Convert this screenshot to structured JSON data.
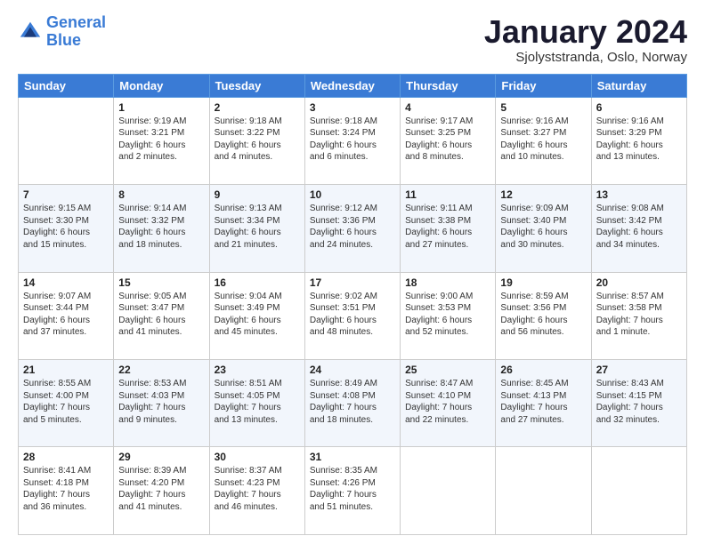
{
  "header": {
    "logo_line1": "General",
    "logo_line2": "Blue",
    "month_title": "January 2024",
    "location": "Sjolyststranda, Oslo, Norway"
  },
  "weekdays": [
    "Sunday",
    "Monday",
    "Tuesday",
    "Wednesday",
    "Thursday",
    "Friday",
    "Saturday"
  ],
  "weeks": [
    [
      {
        "day": "",
        "info": ""
      },
      {
        "day": "1",
        "info": "Sunrise: 9:19 AM\nSunset: 3:21 PM\nDaylight: 6 hours\nand 2 minutes."
      },
      {
        "day": "2",
        "info": "Sunrise: 9:18 AM\nSunset: 3:22 PM\nDaylight: 6 hours\nand 4 minutes."
      },
      {
        "day": "3",
        "info": "Sunrise: 9:18 AM\nSunset: 3:24 PM\nDaylight: 6 hours\nand 6 minutes."
      },
      {
        "day": "4",
        "info": "Sunrise: 9:17 AM\nSunset: 3:25 PM\nDaylight: 6 hours\nand 8 minutes."
      },
      {
        "day": "5",
        "info": "Sunrise: 9:16 AM\nSunset: 3:27 PM\nDaylight: 6 hours\nand 10 minutes."
      },
      {
        "day": "6",
        "info": "Sunrise: 9:16 AM\nSunset: 3:29 PM\nDaylight: 6 hours\nand 13 minutes."
      }
    ],
    [
      {
        "day": "7",
        "info": "Sunrise: 9:15 AM\nSunset: 3:30 PM\nDaylight: 6 hours\nand 15 minutes."
      },
      {
        "day": "8",
        "info": "Sunrise: 9:14 AM\nSunset: 3:32 PM\nDaylight: 6 hours\nand 18 minutes."
      },
      {
        "day": "9",
        "info": "Sunrise: 9:13 AM\nSunset: 3:34 PM\nDaylight: 6 hours\nand 21 minutes."
      },
      {
        "day": "10",
        "info": "Sunrise: 9:12 AM\nSunset: 3:36 PM\nDaylight: 6 hours\nand 24 minutes."
      },
      {
        "day": "11",
        "info": "Sunrise: 9:11 AM\nSunset: 3:38 PM\nDaylight: 6 hours\nand 27 minutes."
      },
      {
        "day": "12",
        "info": "Sunrise: 9:09 AM\nSunset: 3:40 PM\nDaylight: 6 hours\nand 30 minutes."
      },
      {
        "day": "13",
        "info": "Sunrise: 9:08 AM\nSunset: 3:42 PM\nDaylight: 6 hours\nand 34 minutes."
      }
    ],
    [
      {
        "day": "14",
        "info": "Sunrise: 9:07 AM\nSunset: 3:44 PM\nDaylight: 6 hours\nand 37 minutes."
      },
      {
        "day": "15",
        "info": "Sunrise: 9:05 AM\nSunset: 3:47 PM\nDaylight: 6 hours\nand 41 minutes."
      },
      {
        "day": "16",
        "info": "Sunrise: 9:04 AM\nSunset: 3:49 PM\nDaylight: 6 hours\nand 45 minutes."
      },
      {
        "day": "17",
        "info": "Sunrise: 9:02 AM\nSunset: 3:51 PM\nDaylight: 6 hours\nand 48 minutes."
      },
      {
        "day": "18",
        "info": "Sunrise: 9:00 AM\nSunset: 3:53 PM\nDaylight: 6 hours\nand 52 minutes."
      },
      {
        "day": "19",
        "info": "Sunrise: 8:59 AM\nSunset: 3:56 PM\nDaylight: 6 hours\nand 56 minutes."
      },
      {
        "day": "20",
        "info": "Sunrise: 8:57 AM\nSunset: 3:58 PM\nDaylight: 7 hours\nand 1 minute."
      }
    ],
    [
      {
        "day": "21",
        "info": "Sunrise: 8:55 AM\nSunset: 4:00 PM\nDaylight: 7 hours\nand 5 minutes."
      },
      {
        "day": "22",
        "info": "Sunrise: 8:53 AM\nSunset: 4:03 PM\nDaylight: 7 hours\nand 9 minutes."
      },
      {
        "day": "23",
        "info": "Sunrise: 8:51 AM\nSunset: 4:05 PM\nDaylight: 7 hours\nand 13 minutes."
      },
      {
        "day": "24",
        "info": "Sunrise: 8:49 AM\nSunset: 4:08 PM\nDaylight: 7 hours\nand 18 minutes."
      },
      {
        "day": "25",
        "info": "Sunrise: 8:47 AM\nSunset: 4:10 PM\nDaylight: 7 hours\nand 22 minutes."
      },
      {
        "day": "26",
        "info": "Sunrise: 8:45 AM\nSunset: 4:13 PM\nDaylight: 7 hours\nand 27 minutes."
      },
      {
        "day": "27",
        "info": "Sunrise: 8:43 AM\nSunset: 4:15 PM\nDaylight: 7 hours\nand 32 minutes."
      }
    ],
    [
      {
        "day": "28",
        "info": "Sunrise: 8:41 AM\nSunset: 4:18 PM\nDaylight: 7 hours\nand 36 minutes."
      },
      {
        "day": "29",
        "info": "Sunrise: 8:39 AM\nSunset: 4:20 PM\nDaylight: 7 hours\nand 41 minutes."
      },
      {
        "day": "30",
        "info": "Sunrise: 8:37 AM\nSunset: 4:23 PM\nDaylight: 7 hours\nand 46 minutes."
      },
      {
        "day": "31",
        "info": "Sunrise: 8:35 AM\nSunset: 4:26 PM\nDaylight: 7 hours\nand 51 minutes."
      },
      {
        "day": "",
        "info": ""
      },
      {
        "day": "",
        "info": ""
      },
      {
        "day": "",
        "info": ""
      }
    ]
  ]
}
